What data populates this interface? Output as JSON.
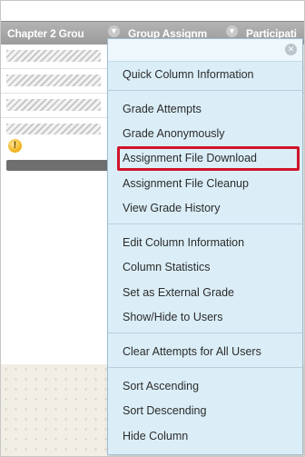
{
  "header": {
    "col1": "Chapter 2 Grou",
    "col2": "Group Assignm",
    "col3": "Participati"
  },
  "menu": {
    "items": [
      "Quick Column Information",
      "Grade Attempts",
      "Grade Anonymously",
      "Assignment File Download",
      "Assignment File Cleanup",
      "View Grade History",
      "Edit Column Information",
      "Column Statistics",
      "Set as External Grade",
      "Show/Hide to Users",
      "Clear Attempts for All Users",
      "Sort Ascending",
      "Sort Descending",
      "Hide Column"
    ],
    "highlighted_item": "Assignment File Download",
    "highlight_color": "#d0142a"
  },
  "icons": {
    "close": "close-icon",
    "chevron": "chevron-down-icon",
    "warning": "warning-icon"
  }
}
